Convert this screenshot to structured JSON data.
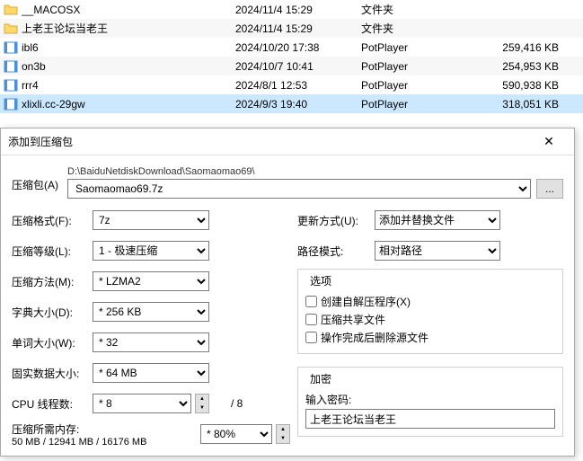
{
  "files": {
    "rows": [
      {
        "icon": "folder",
        "name": "__MACOSX",
        "date": "2024/11/4 15:29",
        "type": "文件夹",
        "size": ""
      },
      {
        "icon": "folder",
        "name": "上老王论坛当老王",
        "date": "2024/11/4 15:29",
        "type": "文件夹",
        "size": ""
      },
      {
        "icon": "file",
        "name": "ibl6",
        "date": "2024/10/20 17:38",
        "type": "PotPlayer",
        "size": "259,416 KB"
      },
      {
        "icon": "file",
        "name": "on3b",
        "date": "2024/10/7 10:41",
        "type": "PotPlayer",
        "size": "254,953 KB"
      },
      {
        "icon": "file",
        "name": "rrr4",
        "date": "2024/8/1 12:53",
        "type": "PotPlayer",
        "size": "590,938 KB"
      },
      {
        "icon": "file",
        "name": "xlixli.cc-29gw",
        "date": "2024/9/3 19:40",
        "type": "PotPlayer",
        "size": "318,051 KB"
      }
    ]
  },
  "dialog": {
    "title": "添加到压缩包",
    "archive_label": "压缩包(A)",
    "path_text": "D:\\BaiduNetdiskDownload\\Saomaomao69\\",
    "archive_name": "Saomaomao69.7z",
    "browse": "...",
    "format_label": "压缩格式(F):",
    "format_value": "7z",
    "level_label": "压缩等级(L):",
    "level_value": "1 - 极速压缩",
    "method_label": "压缩方法(M):",
    "method_value": "* LZMA2",
    "dict_label": "字典大小(D):",
    "dict_value": "* 256 KB",
    "word_label": "单词大小(W):",
    "word_value": "* 32",
    "solid_label": "固实数据大小:",
    "solid_value": "* 64 MB",
    "cpu_label": "CPU 线程数:",
    "cpu_value": "* 8",
    "cpu_max": "/ 8",
    "mem_label": "压缩所需内存:",
    "mem_value": "50 MB / 12941 MB / 16176 MB",
    "mem_pct": "* 80%",
    "update_label": "更新方式(U):",
    "update_value": "添加并替换文件",
    "pathmode_label": "路径模式:",
    "pathmode_value": "相对路径",
    "options_title": "选项",
    "opt_sfx": "创建自解压程序(X)",
    "opt_shared": "压缩共享文件",
    "opt_delete": "操作完成后删除源文件",
    "enc_title": "加密",
    "pwd_label": "输入密码:",
    "pwd_value": "上老王论坛当老王"
  }
}
